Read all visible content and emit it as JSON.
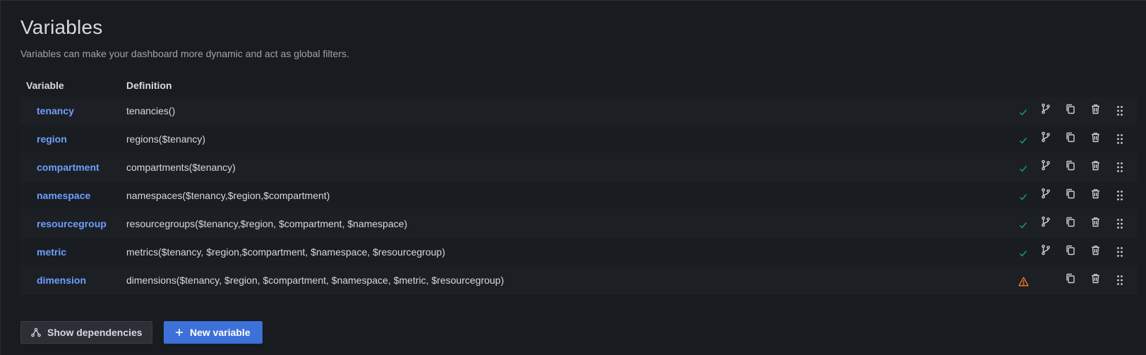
{
  "header": {
    "title": "Variables",
    "subtitle": "Variables can make your dashboard more dynamic and act as global filters."
  },
  "table": {
    "columns": [
      "Variable",
      "Definition"
    ],
    "rows": [
      {
        "name": "tenancy",
        "definition": "tenancies()",
        "status": "ok"
      },
      {
        "name": "region",
        "definition": "regions($tenancy)",
        "status": "ok"
      },
      {
        "name": "compartment",
        "definition": "compartments($tenancy)",
        "status": "ok"
      },
      {
        "name": "namespace",
        "definition": "namespaces($tenancy,$region,$compartment)",
        "status": "ok"
      },
      {
        "name": "resourcegroup",
        "definition": "resourcegroups($tenancy,$region, $compartment, $namespace)",
        "status": "ok"
      },
      {
        "name": "metric",
        "definition": "metrics($tenancy, $region,$compartment, $namespace, $resourcegroup)",
        "status": "ok"
      },
      {
        "name": "dimension",
        "definition": "dimensions($tenancy, $region, $compartment, $namespace, $metric, $resourcegroup)",
        "status": "warning"
      }
    ]
  },
  "footer": {
    "show_dependencies_label": "Show dependencies",
    "new_variable_label": "New variable"
  },
  "icons": {
    "status_ok": "check-icon",
    "status_warning": "warning-triangle-icon",
    "dependencies": "branch-icon",
    "duplicate": "copy-icon",
    "delete": "trash-icon",
    "drag": "drag-handle-icon",
    "show_deps": "graph-nodes-icon",
    "new": "plus-icon"
  },
  "colors": {
    "link": "#6e9fff",
    "ok": "#1a9f5b",
    "warning": "#f07a2b",
    "primary": "#3d71d9"
  }
}
